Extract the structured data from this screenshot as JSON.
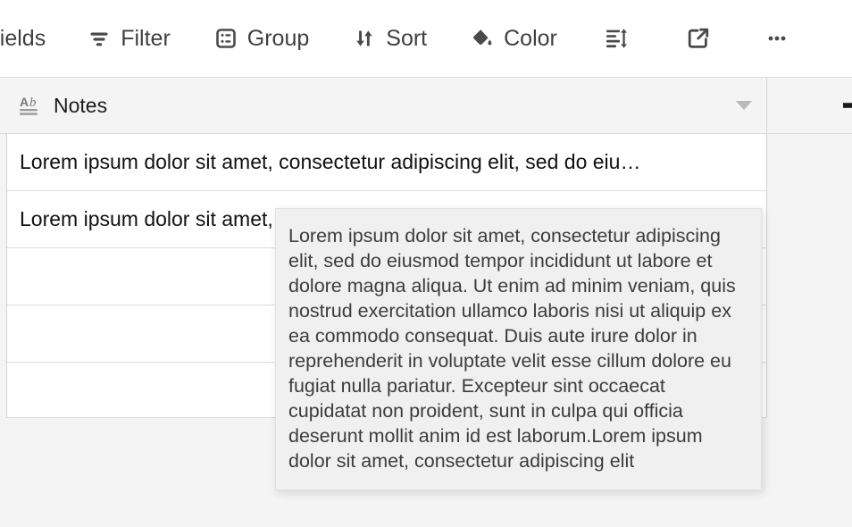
{
  "toolbar": {
    "buttons": [
      {
        "label": "e fields",
        "icon": "hide-fields-icon",
        "name": "hide-fields-button",
        "truncated": true
      },
      {
        "label": "Filter",
        "icon": "filter-icon",
        "name": "filter-button",
        "truncated": false
      },
      {
        "label": "Group",
        "icon": "group-icon",
        "name": "group-button",
        "truncated": false
      },
      {
        "label": "Sort",
        "icon": "sort-icon",
        "name": "sort-button",
        "truncated": false
      },
      {
        "label": "Color",
        "icon": "color-paint-bucket-icon",
        "name": "color-button",
        "truncated": false
      },
      {
        "label": "",
        "icon": "row-height-icon",
        "name": "row-height-button",
        "truncated": false
      },
      {
        "label": "",
        "icon": "share-external-link-icon",
        "name": "share-view-button",
        "truncated": false
      },
      {
        "label": "",
        "icon": "more-ellipsis-icon",
        "name": "more-options-button",
        "truncated": false
      }
    ]
  },
  "grid": {
    "columns": [
      {
        "name": "Notes",
        "field_type_icon": "long-text-ab-icon",
        "has_dropdown": true
      }
    ],
    "add_field_label": "+",
    "rows": [
      {
        "notes": "Lorem ipsum dolor sit amet, consectetur adipiscing elit, sed do eiu…"
      },
      {
        "notes": "Lorem ipsum dolor sit amet, consectetur adipiscing elit, sed do eiu…"
      },
      {
        "notes": ""
      },
      {
        "notes": ""
      },
      {
        "notes": ""
      }
    ]
  },
  "tooltip": {
    "visible": true,
    "text": "Lorem ipsum dolor sit amet, consectetur adipiscing elit, sed do eiusmod tempor incididunt ut labore et dolore magna aliqua. Ut enim ad minim veniam, quis nostrud exercitation ullamco laboris nisi ut aliquip ex ea commodo consequat. Duis aute irure dolor in reprehenderit in voluptate velit esse cillum dolore eu fugiat nulla pariatur. Excepteur sint occaecat cupidatat non proident, sunt in culpa qui officia deserunt mollit anim id est laborum.Lorem ipsum dolor sit amet, consectetur adipiscing elit"
  },
  "colors": {
    "toolbar_bg": "#ffffff",
    "toolbar_text": "#3f3f3f",
    "grid_header_bg": "#f4f4f4",
    "row_bg": "#ffffff",
    "row_border": "#d8dcde",
    "page_bg": "#f4f4f4",
    "tooltip_bg": "#f0f0f0",
    "tooltip_text": "#3c3c3c",
    "cell_text": "#111111"
  }
}
